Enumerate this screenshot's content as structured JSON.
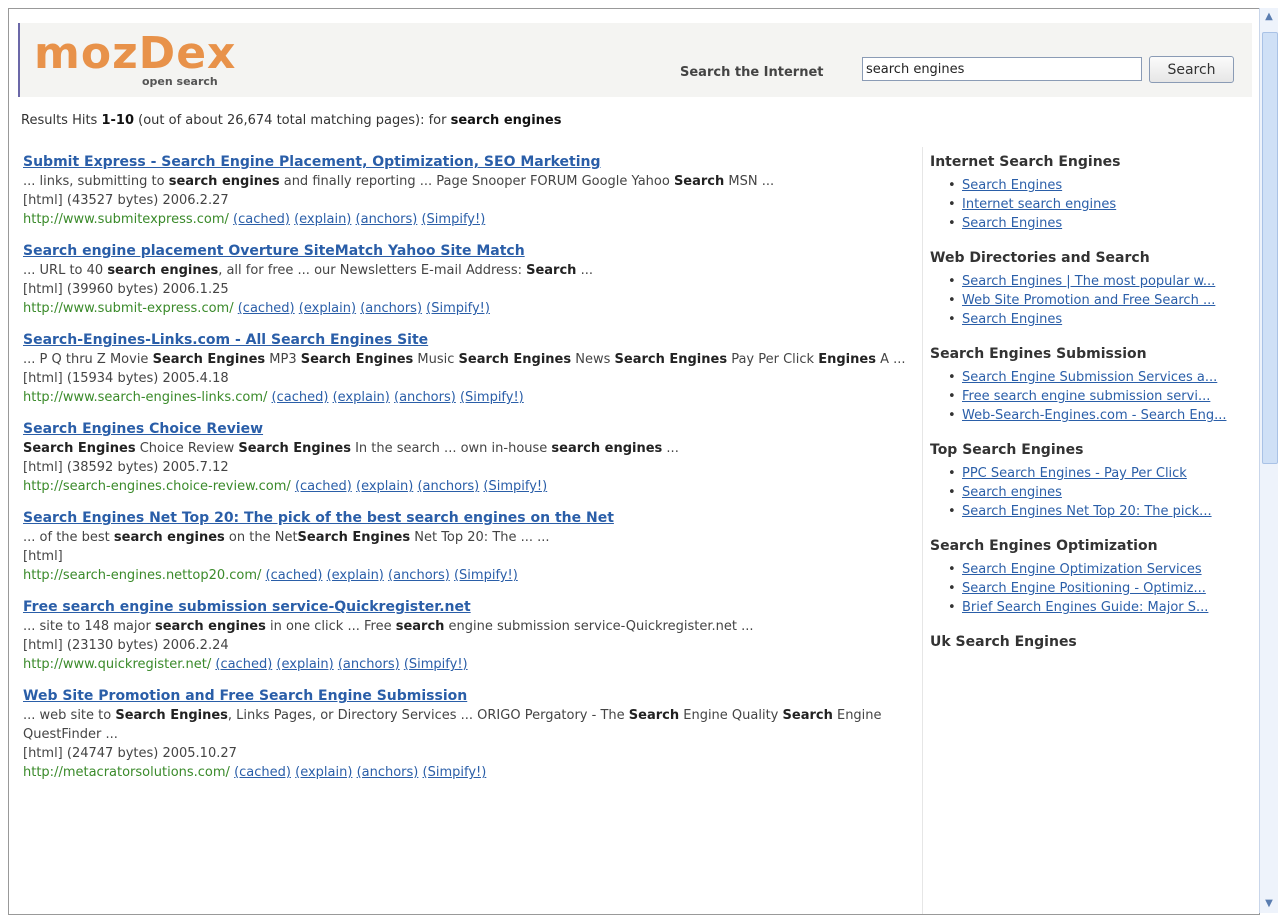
{
  "brand": {
    "logo": "mozDex",
    "tagline": "open search"
  },
  "search": {
    "label": "Search the Internet",
    "value": "search engines",
    "button": "Search"
  },
  "summary": {
    "prefix": "Results Hits ",
    "range": "1-10",
    "middle": " (out of about 26,674 total matching pages): for ",
    "query": "search engines"
  },
  "results": [
    {
      "title": "Submit Express - Search Engine Placement, Optimization, SEO Marketing",
      "snippet": [
        [
          "... links, submitting to ",
          false
        ],
        [
          "search engines",
          true
        ],
        [
          " and finally reporting ... Page Snooper FORUM Google Yahoo ",
          false
        ],
        [
          "Search",
          true
        ],
        [
          " MSN ...",
          false
        ]
      ],
      "meta": "[html] (43527 bytes) 2006.2.27",
      "url": "http://www.submitexpress.com/",
      "links": [
        "(cached)",
        "(explain)",
        "(anchors)",
        "(Simpify!)"
      ]
    },
    {
      "title": "Search engine placement Overture SiteMatch Yahoo Site Match",
      "snippet": [
        [
          "... URL to 40 ",
          false
        ],
        [
          "search engines",
          true
        ],
        [
          ", all for free ... our Newsletters E-mail Address:   ",
          false
        ],
        [
          "Search",
          true
        ],
        [
          " ...",
          false
        ]
      ],
      "meta": "[html] (39960 bytes) 2006.1.25",
      "url": "http://www.submit-express.com/",
      "links": [
        "(cached)",
        "(explain)",
        "(anchors)",
        "(Simpify!)"
      ]
    },
    {
      "title": "Search-Engines-Links.com - All Search Engines Site",
      "snippet": [
        [
          "... P     Q thru Z Movie ",
          false
        ],
        [
          "Search Engines",
          true
        ],
        [
          " MP3 ",
          false
        ],
        [
          "Search Engines",
          true
        ],
        [
          " Music ",
          false
        ],
        [
          "Search Engines",
          true
        ],
        [
          " News ",
          false
        ],
        [
          "Search Engines",
          true
        ],
        [
          " Pay Per Click ",
          false
        ],
        [
          "Engines",
          true
        ],
        [
          "     A ...",
          false
        ]
      ],
      "meta": "[html] (15934 bytes) 2005.4.18",
      "url": "http://www.search-engines-links.com/",
      "links": [
        "(cached)",
        "(explain)",
        "(anchors)",
        "(Simpify!)"
      ]
    },
    {
      "title": "Search Engines Choice Review",
      "snippet": [
        [
          "Search Engines",
          true
        ],
        [
          " Choice Review     ",
          false
        ],
        [
          "Search Engines",
          true
        ],
        [
          " In the search ... own in-house ",
          false
        ],
        [
          "search engines",
          true
        ],
        [
          " ...",
          false
        ]
      ],
      "meta": "[html] (38592 bytes) 2005.7.12",
      "url": "http://search-engines.choice-review.com/",
      "links": [
        "(cached)",
        "(explain)",
        "(anchors)",
        "(Simpify!)"
      ]
    },
    {
      "title": "Search Engines Net Top 20: The pick of the best search engines on the Net",
      "snippet": [
        [
          "... of the best ",
          false
        ],
        [
          "search engines",
          true
        ],
        [
          " on the Net",
          false
        ],
        [
          "Search Engines",
          true
        ],
        [
          " Net Top 20: The ... ...",
          false
        ]
      ],
      "meta": "[html]",
      "url": "http://search-engines.nettop20.com/",
      "links": [
        "(cached)",
        "(explain)",
        "(anchors)",
        "(Simpify!)"
      ]
    },
    {
      "title": "Free search engine submission service-Quickregister.net",
      "snippet": [
        [
          "... site to 148 major ",
          false
        ],
        [
          "search engines",
          true
        ],
        [
          " in one click ... Free ",
          false
        ],
        [
          "search",
          true
        ],
        [
          " engine submission service-Quickregister.net ...",
          false
        ]
      ],
      "meta": "[html] (23130 bytes) 2006.2.24",
      "url": "http://www.quickregister.net/",
      "links": [
        "(cached)",
        "(explain)",
        "(anchors)",
        "(Simpify!)"
      ]
    },
    {
      "title": "Web Site Promotion and Free Search Engine Submission",
      "snippet": [
        [
          "... web site to ",
          false
        ],
        [
          "Search Engines",
          true
        ],
        [
          ", Links Pages, or Directory Services ... ORIGO Pergatory - The ",
          false
        ],
        [
          "Search",
          true
        ],
        [
          " Engine Quality ",
          false
        ],
        [
          "Search",
          true
        ],
        [
          " Engine QuestFinder ...",
          false
        ]
      ],
      "meta": "[html] (24747 bytes) 2005.10.27",
      "url": "http://metacratorsolutions.com/",
      "links": [
        "(cached)",
        "(explain)",
        "(anchors)",
        "(Simpify!)"
      ]
    }
  ],
  "sidebar": [
    {
      "heading": "Internet Search Engines",
      "items": [
        "Search Engines",
        "Internet search engines",
        "Search Engines"
      ]
    },
    {
      "heading": "Web Directories and Search",
      "items": [
        "Search Engines | The most popular w...",
        "Web Site Promotion and Free Search ...",
        "Search Engines"
      ]
    },
    {
      "heading": "Search Engines Submission",
      "items": [
        "Search Engine Submission Services a...",
        "Free search engine submission servi...",
        "Web-Search-Engines.com - Search Eng..."
      ]
    },
    {
      "heading": "Top Search Engines",
      "items": [
        "PPC Search Engines - Pay Per Click",
        "Search engines",
        "Search Engines Net Top 20: The pick..."
      ]
    },
    {
      "heading": "Search Engines Optimization",
      "items": [
        "Search Engine Optimization Services",
        "Search Engine Positioning - Optimiz...",
        "Brief Search Engines Guide: Major S..."
      ]
    },
    {
      "heading": "Uk Search Engines",
      "items": []
    }
  ],
  "scrollbar": {
    "up_icon": "▲",
    "down_icon": "▼"
  }
}
